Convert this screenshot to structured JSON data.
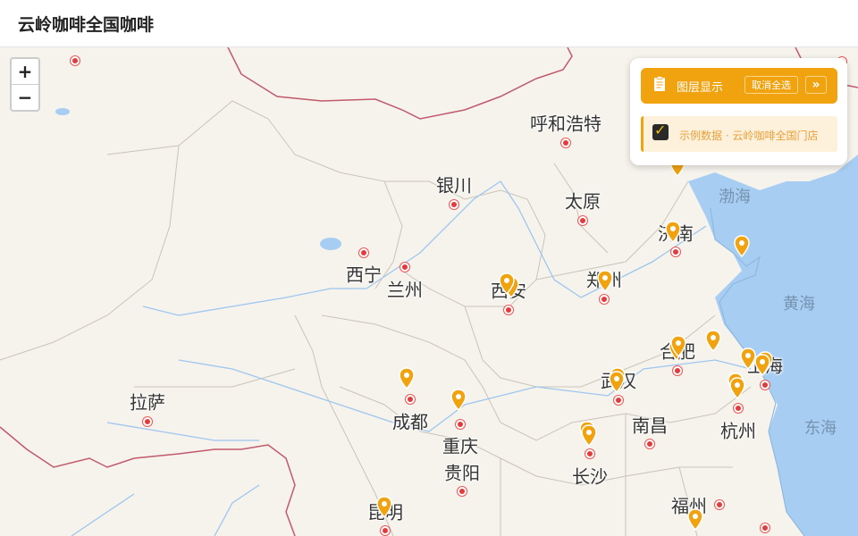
{
  "app": {
    "title": "云岭咖啡全国咖啡"
  },
  "zoom": {
    "in_label": "+",
    "out_label": "−"
  },
  "layers_panel": {
    "header_label": "图层显示",
    "clear_button": "取消全选",
    "more_button": "»",
    "layers": [
      {
        "label": "示例数据 · 云岭咖啡全国门店",
        "checked": true
      }
    ]
  },
  "map": {
    "colors": {
      "land": "#f6f3ec",
      "water": "#a8cdf2",
      "rivers": "#9ec6f0",
      "border": "#c05a6c",
      "marker": "#f0a20f",
      "city_dot": "#e33b3b"
    },
    "cities": [
      {
        "name": "呼和浩特"
      },
      {
        "name": "银川"
      },
      {
        "name": "太原"
      },
      {
        "name": "济南"
      },
      {
        "name": "西宁"
      },
      {
        "name": "兰州"
      },
      {
        "name": "西安"
      },
      {
        "name": "郑州"
      },
      {
        "name": "合肥"
      },
      {
        "name": "上海"
      },
      {
        "name": "武汉"
      },
      {
        "name": "拉萨"
      },
      {
        "name": "成都"
      },
      {
        "name": "重庆"
      },
      {
        "name": "南昌"
      },
      {
        "name": "杭州"
      },
      {
        "name": "贵阳"
      },
      {
        "name": "长沙"
      },
      {
        "name": "福州"
      },
      {
        "name": "昆明"
      }
    ],
    "seas": [
      {
        "name": "渤海"
      },
      {
        "name": "黄海"
      },
      {
        "name": "东海"
      }
    ],
    "store_markers": 22
  }
}
